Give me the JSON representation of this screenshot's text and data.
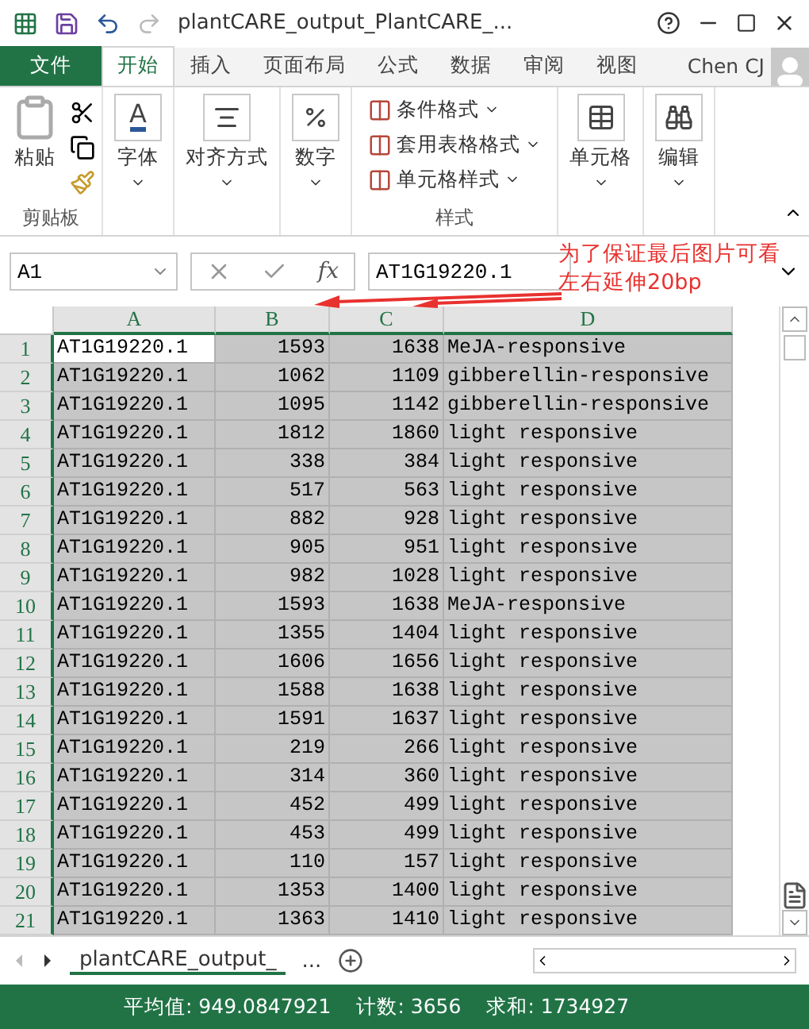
{
  "window": {
    "title": "plantCARE_output_PlantCARE_...",
    "user": "Chen CJ"
  },
  "ribbon_tabs": [
    {
      "label": "文件",
      "kind": "file",
      "selected": false
    },
    {
      "label": "开始",
      "kind": "tab",
      "selected": true
    },
    {
      "label": "插入",
      "kind": "tab",
      "selected": false
    },
    {
      "label": "页面布局",
      "kind": "tab",
      "selected": false
    },
    {
      "label": "公式",
      "kind": "tab",
      "selected": false
    },
    {
      "label": "数据",
      "kind": "tab",
      "selected": false
    },
    {
      "label": "审阅",
      "kind": "tab",
      "selected": false
    },
    {
      "label": "视图",
      "kind": "tab",
      "selected": false
    }
  ],
  "clipboard": {
    "paste": "粘贴",
    "title": "剪贴板"
  },
  "big_buttons": [
    {
      "label": "字体",
      "kind": "font",
      "glyph": "A"
    },
    {
      "label": "对齐方式",
      "kind": "align"
    },
    {
      "label": "数字",
      "kind": "number"
    }
  ],
  "styles": {
    "items": [
      "条件格式",
      "套用表格格式",
      "单元格样式"
    ],
    "title": "样式"
  },
  "end_buttons": [
    {
      "label": "单元格",
      "kind": "cells"
    },
    {
      "label": "编辑",
      "kind": "edit"
    }
  ],
  "formula_bar": {
    "name_box": "A1",
    "fx": "fx",
    "value": "AT1G19220.1"
  },
  "columns": [
    "A",
    "B",
    "C",
    "D"
  ],
  "rows": [
    {
      "header": "1",
      "active": true,
      "cells": [
        "AT1G19220.1",
        "1593",
        "1638",
        "MeJA-responsive"
      ]
    },
    {
      "header": "2",
      "active": false,
      "cells": [
        "AT1G19220.1",
        "1062",
        "1109",
        "gibberellin-responsive"
      ]
    },
    {
      "header": "3",
      "active": false,
      "cells": [
        "AT1G19220.1",
        "1095",
        "1142",
        "gibberellin-responsive"
      ]
    },
    {
      "header": "4",
      "active": false,
      "cells": [
        "AT1G19220.1",
        "1812",
        "1860",
        "light responsive"
      ]
    },
    {
      "header": "5",
      "active": false,
      "cells": [
        "AT1G19220.1",
        "338",
        "384",
        "light responsive"
      ]
    },
    {
      "header": "6",
      "active": false,
      "cells": [
        "AT1G19220.1",
        "517",
        "563",
        "light responsive"
      ]
    },
    {
      "header": "7",
      "active": false,
      "cells": [
        "AT1G19220.1",
        "882",
        "928",
        "light responsive"
      ]
    },
    {
      "header": "8",
      "active": false,
      "cells": [
        "AT1G19220.1",
        "905",
        "951",
        "light responsive"
      ]
    },
    {
      "header": "9",
      "active": false,
      "cells": [
        "AT1G19220.1",
        "982",
        "1028",
        "light responsive"
      ]
    },
    {
      "header": "10",
      "active": false,
      "cells": [
        "AT1G19220.1",
        "1593",
        "1638",
        "MeJA-responsive"
      ]
    },
    {
      "header": "11",
      "active": false,
      "cells": [
        "AT1G19220.1",
        "1355",
        "1404",
        "light responsive"
      ]
    },
    {
      "header": "12",
      "active": false,
      "cells": [
        "AT1G19220.1",
        "1606",
        "1656",
        "light responsive"
      ]
    },
    {
      "header": "13",
      "active": false,
      "cells": [
        "AT1G19220.1",
        "1588",
        "1638",
        "light responsive"
      ]
    },
    {
      "header": "14",
      "active": false,
      "cells": [
        "AT1G19220.1",
        "1591",
        "1637",
        "light responsive"
      ]
    },
    {
      "header": "15",
      "active": false,
      "cells": [
        "AT1G19220.1",
        "219",
        "266",
        "light responsive"
      ]
    },
    {
      "header": "16",
      "active": false,
      "cells": [
        "AT1G19220.1",
        "314",
        "360",
        "light responsive"
      ]
    },
    {
      "header": "17",
      "active": false,
      "cells": [
        "AT1G19220.1",
        "452",
        "499",
        "light responsive"
      ]
    },
    {
      "header": "18",
      "active": false,
      "cells": [
        "AT1G19220.1",
        "453",
        "499",
        "light responsive"
      ]
    },
    {
      "header": "19",
      "active": false,
      "cells": [
        "AT1G19220.1",
        "110",
        "157",
        "light responsive"
      ]
    },
    {
      "header": "20",
      "active": false,
      "cells": [
        "AT1G19220.1",
        "1353",
        "1400",
        "light responsive"
      ]
    },
    {
      "header": "21",
      "active": false,
      "cells": [
        "AT1G19220.1",
        "1363",
        "1410",
        "light responsive"
      ]
    }
  ],
  "sheet_tabs": [
    {
      "label": "plantCARE_output_",
      "selected": true
    }
  ],
  "sheet_more": "...",
  "status_bar": [
    "平均值: 949.0847921",
    "计数: 3656",
    "求和: 1734927"
  ],
  "annotation": [
    "为了保证最后图片可看",
    "左右延伸20bp"
  ]
}
